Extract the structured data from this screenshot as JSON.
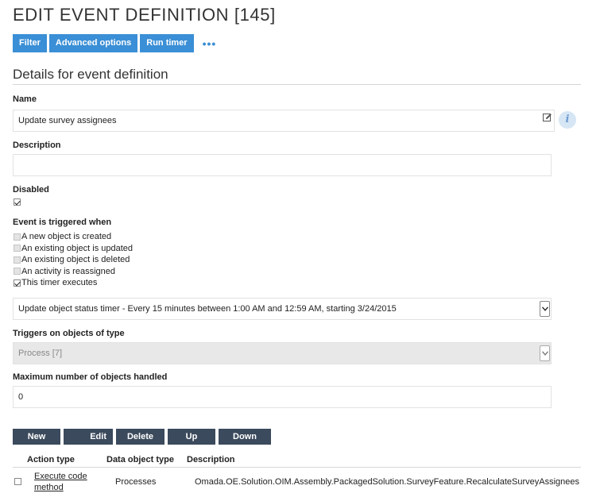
{
  "page": {
    "title": "EDIT EVENT DEFINITION [145]"
  },
  "toolbar": {
    "filter_label": "Filter",
    "advanced_label": "Advanced options",
    "run_timer_label": "Run timer",
    "more_label": "•••"
  },
  "section": {
    "title": "Details for event definition"
  },
  "form": {
    "name_label": "Name",
    "name_value": "Update survey assignees",
    "description_label": "Description",
    "description_value": "",
    "disabled_label": "Disabled",
    "disabled_checked": true,
    "trigger_label": "Event is triggered when",
    "triggers": [
      {
        "label": "A new object is created",
        "checked": false,
        "enabled": false
      },
      {
        "label": "An existing object is updated",
        "checked": false,
        "enabled": false
      },
      {
        "label": "An existing object is deleted",
        "checked": false,
        "enabled": false
      },
      {
        "label": "An activity is reassigned",
        "checked": false,
        "enabled": false
      },
      {
        "label": "This timer executes",
        "checked": true,
        "enabled": true
      }
    ],
    "timer_value": "Update object status timer - Every 15 minutes between 1:00 AM and 12:59 AM, starting 3/24/2015",
    "object_type_label": "Triggers on objects of type",
    "object_type_value": "Process [7]",
    "max_objects_label": "Maximum number of objects handled",
    "max_objects_value": "0"
  },
  "actions": {
    "new_label": "New",
    "edit_label": "Edit",
    "delete_label": "Delete",
    "up_label": "Up",
    "down_label": "Down"
  },
  "table": {
    "headers": [
      "Action type",
      "Data object type",
      "Description"
    ],
    "rows": [
      {
        "action_type_line1": "Execute code",
        "action_type_line2": "method",
        "data_object_type": "Processes",
        "description": "Omada.OE.Solution.OIM.Assembly.PackagedSolution.SurveyFeature.RecalculateSurveyAssignees"
      }
    ]
  },
  "colors": {
    "primary_button": "#3a8fd6",
    "dark_button": "#3b4a5c"
  }
}
